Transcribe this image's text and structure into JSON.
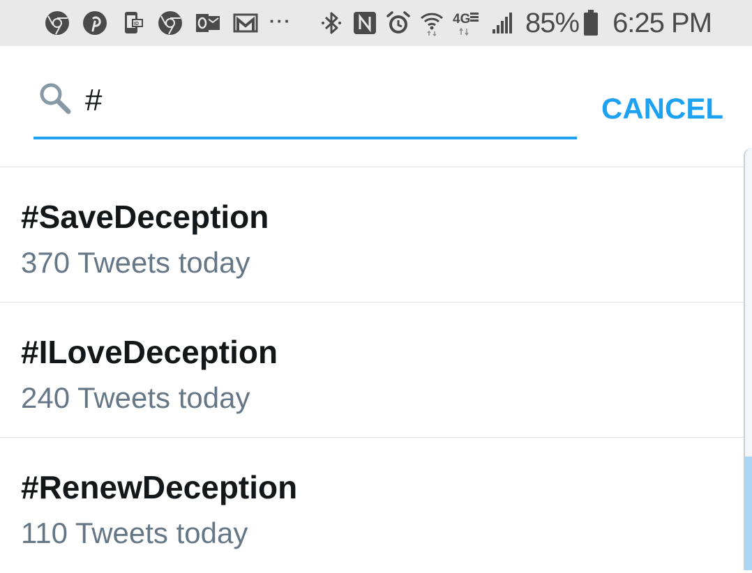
{
  "status_bar": {
    "notification_icons": [
      "chrome-icon",
      "pinterest-icon",
      "caller-id-icon",
      "chrome-icon",
      "outlook-icon",
      "gmail-icon"
    ],
    "overflow_text": "···",
    "system_icons": [
      "bluetooth-icon",
      "nfc-icon",
      "alarm-icon",
      "wifi-icon",
      "lte-icon",
      "signal-icon"
    ],
    "network_label": "4G",
    "battery_percent": "85%",
    "time": "6:25 PM"
  },
  "search": {
    "query": "#",
    "cancel_label": "CANCEL"
  },
  "results": [
    {
      "title": "#SaveDeception",
      "subtitle": "370 Tweets today"
    },
    {
      "title": "#ILoveDeception",
      "subtitle": "240 Tweets today"
    },
    {
      "title": "#RenewDeception",
      "subtitle": "110 Tweets today"
    }
  ],
  "colors": {
    "accent": "#1da1f2",
    "primary_text": "#14171a",
    "secondary_text": "#657786",
    "status_bar_bg": "#e9e9e9",
    "divider": "#dde3e8"
  }
}
